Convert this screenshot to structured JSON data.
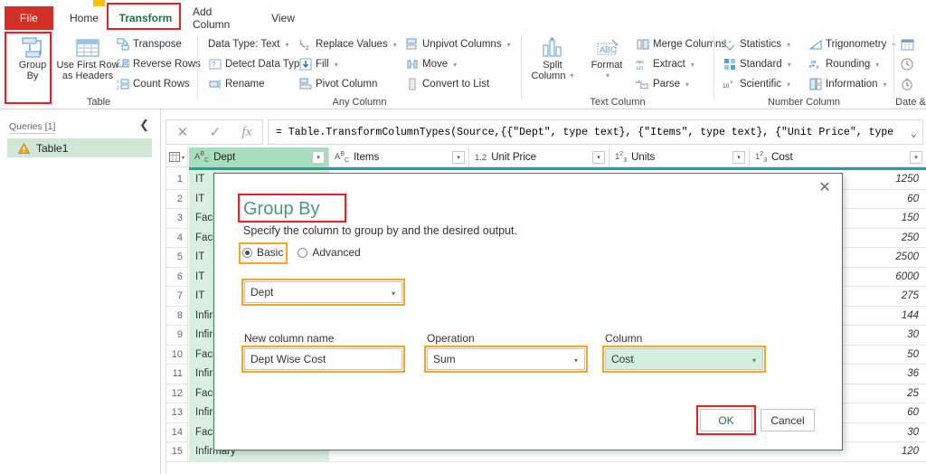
{
  "window": {
    "notch_color": "#ffc000"
  },
  "ribbon": {
    "tabs": [
      {
        "label": "File",
        "name": "tab-file"
      },
      {
        "label": "Home",
        "name": "tab-home"
      },
      {
        "label": "Transform",
        "name": "tab-transform"
      },
      {
        "label": "Add Column",
        "name": "tab-add-column"
      },
      {
        "label": "View",
        "name": "tab-view"
      }
    ],
    "selected_tab": "Transform",
    "groups": [
      {
        "title": "Table",
        "big_buttons": [
          {
            "label_line1": "Group",
            "label_line2": "By",
            "icon": "group-by-icon"
          },
          {
            "label_line1": "Use First Row",
            "label_line2": "as Headers",
            "icon": "use-first-row-as-headers-icon",
            "caret": true
          }
        ],
        "small_buttons": [
          {
            "label": "Transpose",
            "icon": "transpose-icon",
            "caret": false
          },
          {
            "label": "Reverse Rows",
            "icon": "reverse-rows-icon",
            "caret": false
          },
          {
            "label": "Count Rows",
            "icon": "count-rows-icon",
            "caret": false
          }
        ]
      },
      {
        "title": "Any Column",
        "small_buttons": [
          {
            "label": "Data Type: Text",
            "icon": "data-type-icon",
            "caret": true
          },
          {
            "label": "Detect Data Type",
            "icon": "detect-data-type-icon",
            "caret": false
          },
          {
            "label": "Rename",
            "icon": "rename-icon",
            "caret": false
          },
          {
            "label": "Replace Values",
            "icon": "replace-values-icon",
            "caret": true
          },
          {
            "label": "Fill",
            "icon": "fill-icon",
            "caret": true
          },
          {
            "label": "Pivot Column",
            "icon": "pivot-column-icon",
            "caret": false
          },
          {
            "label": "Unpivot Columns",
            "icon": "unpivot-columns-icon",
            "caret": true
          },
          {
            "label": "Move",
            "icon": "move-icon",
            "caret": true
          },
          {
            "label": "Convert to List",
            "icon": "convert-to-list-icon",
            "caret": false
          }
        ]
      },
      {
        "title": "Text Column",
        "big_buttons": [
          {
            "label_line1": "Split",
            "label_line2": "Column",
            "icon": "split-column-icon",
            "caret": true
          },
          {
            "label_line1": "Format",
            "label_line2": "",
            "icon": "format-icon",
            "caret": true
          }
        ],
        "small_buttons": [
          {
            "label": "Merge Columns",
            "icon": "merge-columns-icon",
            "caret": false
          },
          {
            "label": "Extract",
            "icon": "extract-icon",
            "caret": true
          },
          {
            "label": "Parse",
            "icon": "parse-icon",
            "caret": true
          }
        ]
      },
      {
        "title": "Number Column",
        "small_buttons": [
          {
            "label": "Statistics",
            "icon": "statistics-icon",
            "caret": true
          },
          {
            "label": "Standard",
            "icon": "standard-icon",
            "caret": true
          },
          {
            "label": "Scientific",
            "icon": "scientific-icon",
            "caret": true
          },
          {
            "label": "Trigonometry",
            "icon": "trigonometry-icon",
            "caret": true
          },
          {
            "label": "Rounding",
            "icon": "rounding-icon",
            "caret": true
          },
          {
            "label": "Information",
            "icon": "information-icon",
            "caret": true
          }
        ]
      },
      {
        "title": "Date &",
        "small_buttons": [
          {
            "label": "",
            "icon": "date-icon",
            "caret": true
          },
          {
            "label": "",
            "icon": "time-icon",
            "caret": true
          },
          {
            "label": "",
            "icon": "duration-icon",
            "caret": true
          }
        ]
      }
    ]
  },
  "formula_bar": {
    "cancel_icon": "cancel-icon",
    "commit_icon": "check-icon",
    "fx_icon": "fx-icon",
    "value": "= Table.TransformColumnTypes(Source,{{\"Dept\", type text}, {\"Items\", type text}, {\"Unit Price\", type",
    "expand_icon": "chevron-down-icon"
  },
  "queries_pane": {
    "header": "Queries [1]",
    "collapse_icon": "chevron-left-icon",
    "items": [
      {
        "label": "Table1",
        "icon": "warning-icon",
        "selected": true
      }
    ]
  },
  "grid": {
    "columns": [
      {
        "name": "Dept",
        "type_badge": "ABC",
        "type_kind": "text",
        "selected": true
      },
      {
        "name": "Items",
        "type_badge": "ABC",
        "type_kind": "text",
        "selected": false
      },
      {
        "name": "Unit Price",
        "type_badge": "1.2",
        "type_kind": "decimal",
        "selected": false
      },
      {
        "name": "Units",
        "type_badge": "123",
        "type_kind": "integer",
        "selected": false
      },
      {
        "name": "Cost",
        "type_badge": "123",
        "type_kind": "integer",
        "selected": false
      }
    ],
    "rows": [
      {
        "n": "1",
        "dept": "IT",
        "cost": "1250"
      },
      {
        "n": "2",
        "dept": "IT",
        "cost": "60"
      },
      {
        "n": "3",
        "dept": "Facilities",
        "cost": "150"
      },
      {
        "n": "4",
        "dept": "Facilities",
        "cost": "250"
      },
      {
        "n": "5",
        "dept": "IT",
        "cost": "2500"
      },
      {
        "n": "6",
        "dept": "IT",
        "cost": "6000"
      },
      {
        "n": "7",
        "dept": "IT",
        "cost": "275"
      },
      {
        "n": "8",
        "dept": "Infirmary",
        "cost": "144"
      },
      {
        "n": "9",
        "dept": "Infirmary",
        "cost": "30"
      },
      {
        "n": "10",
        "dept": "Facilities",
        "cost": "50"
      },
      {
        "n": "11",
        "dept": "Infirmary",
        "cost": "36"
      },
      {
        "n": "12",
        "dept": "Facilities",
        "cost": "25"
      },
      {
        "n": "13",
        "dept": "Infirmary",
        "cost": "60"
      },
      {
        "n": "14",
        "dept": "Facilities",
        "cost": "30"
      },
      {
        "n": "15",
        "dept": "Infirmary",
        "cost": "120"
      }
    ]
  },
  "dialog": {
    "title": "Group By",
    "subtitle": "Specify the column to group by and the desired output.",
    "close_icon": "close-icon",
    "modes": [
      {
        "label": "Basic",
        "selected": true
      },
      {
        "label": "Advanced",
        "selected": false
      }
    ],
    "group_by_select": {
      "value": "Dept",
      "caret_icon": "chevron-down-icon"
    },
    "fields": [
      {
        "label": "New column name",
        "value": "Dept Wise Cost",
        "kind": "text"
      },
      {
        "label": "Operation",
        "value": "Sum",
        "kind": "select"
      },
      {
        "label": "Column",
        "value": "Cost",
        "kind": "select",
        "highlight_fill": "#d3efdd"
      }
    ],
    "buttons": [
      {
        "label": "OK",
        "primary": true
      },
      {
        "label": "Cancel",
        "primary": false
      }
    ]
  },
  "annotations": {
    "orange": "#f5a623",
    "red": "#ee1c25"
  }
}
